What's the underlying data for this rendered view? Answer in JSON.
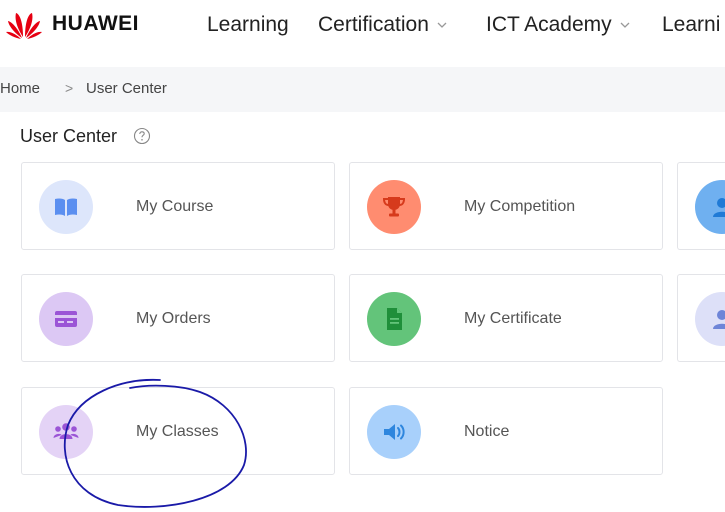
{
  "header": {
    "brand": "HUAWEI",
    "nav": [
      {
        "label": "Learning",
        "has_dropdown": false
      },
      {
        "label": "Certification",
        "has_dropdown": true
      },
      {
        "label": "ICT Academy",
        "has_dropdown": true
      },
      {
        "label": "Learni",
        "has_dropdown": false
      }
    ],
    "logo_color": "#e60012"
  },
  "breadcrumb": {
    "home": "Home",
    "separator": ">",
    "current": "User Center"
  },
  "page": {
    "title": "User Center",
    "help_icon": "question-circle-icon"
  },
  "cards": [
    {
      "label": "My Course",
      "icon": "book-icon",
      "circle_color": "#dde6fb",
      "icon_color": "#5b8ff0"
    },
    {
      "label": "My Competition",
      "icon": "trophy-icon",
      "circle_color": "#ff8c70",
      "icon_color": "#d63a1c"
    },
    {
      "label": "",
      "icon": "user-icon",
      "circle_color": "#6fb0f0",
      "icon_color": "#1f7ad6"
    },
    {
      "label": "My Orders",
      "icon": "card-icon",
      "circle_color": "#dcc8f4",
      "icon_color": "#9b55d6"
    },
    {
      "label": "My Certificate",
      "icon": "document-icon",
      "circle_color": "#63c47a",
      "icon_color": "#1f8f3a"
    },
    {
      "label": "",
      "icon": "user-icon",
      "circle_color": "#dde0f8",
      "icon_color": "#6e85d8"
    },
    {
      "label": "My Classes",
      "icon": "group-icon",
      "circle_color": "#e4d3f6",
      "icon_color": "#9b55d6"
    },
    {
      "label": "Notice",
      "icon": "speaker-icon",
      "circle_color": "#a8d0fb",
      "icon_color": "#2e86de"
    }
  ],
  "annotation_color": "#1a1aa8"
}
